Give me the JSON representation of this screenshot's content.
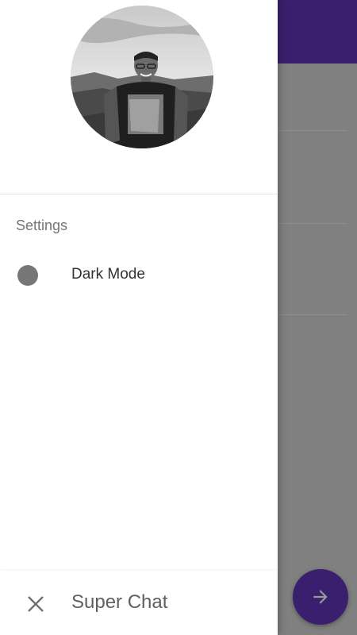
{
  "drawer": {
    "profile_avatar": "profile-photo",
    "section_title": "Settings",
    "items": [
      {
        "label": "Dark Mode",
        "icon": "circle-toggle-icon",
        "icon_color": "#777777"
      }
    ]
  },
  "bottom_bar": {
    "close_icon": "close-icon",
    "title": "Super Chat"
  },
  "background": {
    "appbar_color": "#3a1f6e",
    "scrim_color": "#808080",
    "fab_icon": "arrow-right-icon",
    "fab_color": "#3a1f6e"
  }
}
